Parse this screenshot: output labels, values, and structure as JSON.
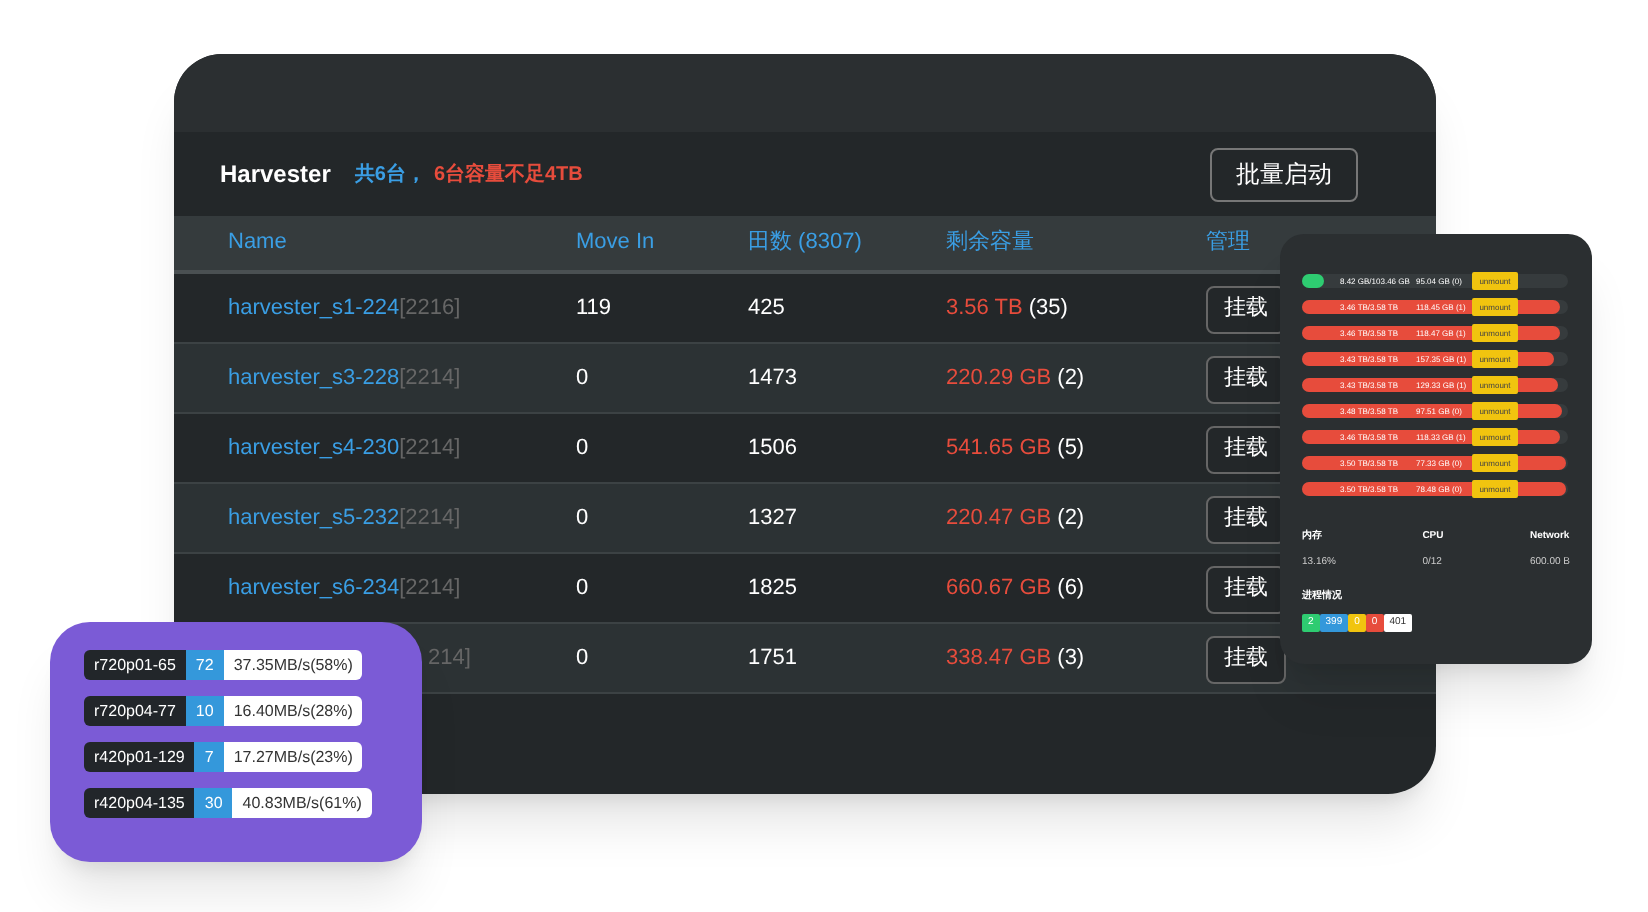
{
  "harvester": {
    "title": "Harvester",
    "summary": "共6台，",
    "warning": "6台容量不足4TB",
    "batch_button": "批量启动",
    "columns": [
      "Name",
      "Move In",
      "田数 (8307)",
      "剩余容量",
      "管理"
    ],
    "rows": [
      {
        "name": "harvester_s1-224",
        "tag": "[2216]",
        "move_in": "119",
        "plots": "425",
        "free": "3.56 TB",
        "count": "(35)",
        "action": "挂载"
      },
      {
        "name": "harvester_s3-228",
        "tag": "[2214]",
        "move_in": "0",
        "plots": "1473",
        "free": "220.29 GB",
        "count": "(2)",
        "action": "挂载"
      },
      {
        "name": "harvester_s4-230",
        "tag": "[2214]",
        "move_in": "0",
        "plots": "1506",
        "free": "541.65 GB",
        "count": "(5)",
        "action": "挂载"
      },
      {
        "name": "harvester_s5-232",
        "tag": "[2214]",
        "move_in": "0",
        "plots": "1327",
        "free": "220.47 GB",
        "count": "(2)",
        "action": "挂载"
      },
      {
        "name": "harvester_s6-234",
        "tag": "[2214]",
        "move_in": "0",
        "plots": "1825",
        "free": "660.67 GB",
        "count": "(6)",
        "action": "挂载"
      },
      {
        "name": "",
        "tag": "214]",
        "move_in": "0",
        "plots": "1751",
        "free": "338.47 GB",
        "count": "(3)",
        "action": "挂载"
      }
    ]
  },
  "disks": {
    "items": [
      {
        "used": "8.42 GB/103.46 GB",
        "free": "95.04 GB (0)",
        "level": 0.08,
        "color": "#2ecc71",
        "button": "unmount"
      },
      {
        "used": "3.46 TB/3.58 TB",
        "free": "118.45 GB (1)",
        "level": 0.97,
        "color": "#e74c3c",
        "button": "unmount"
      },
      {
        "used": "3.46 TB/3.58 TB",
        "free": "118.47 GB (1)",
        "level": 0.97,
        "color": "#e74c3c",
        "button": "unmount"
      },
      {
        "used": "3.43 TB/3.58 TB",
        "free": "157.35 GB (1)",
        "level": 0.95,
        "color": "#e74c3c",
        "button": "unmount"
      },
      {
        "used": "3.43 TB/3.58 TB",
        "free": "129.33 GB (1)",
        "level": 0.96,
        "color": "#e74c3c",
        "button": "unmount"
      },
      {
        "used": "3.48 TB/3.58 TB",
        "free": "97.51 GB (0)",
        "level": 0.98,
        "color": "#e74c3c",
        "button": "unmount"
      },
      {
        "used": "3.46 TB/3.58 TB",
        "free": "118.33 GB (1)",
        "level": 0.97,
        "color": "#e74c3c",
        "button": "unmount"
      },
      {
        "used": "3.50 TB/3.58 TB",
        "free": "77.33 GB (0)",
        "level": 0.99,
        "color": "#e74c3c",
        "button": "unmount"
      },
      {
        "used": "3.50 TB/3.58 TB",
        "free": "78.48 GB (0)",
        "level": 0.99,
        "color": "#e74c3c",
        "button": "unmount"
      }
    ],
    "stats": [
      {
        "label": "内存",
        "value": "13.16%"
      },
      {
        "label": "CPU",
        "value": "0/12"
      },
      {
        "label": "Network",
        "value": "600.00 B"
      }
    ],
    "process_title": "进程情况",
    "process_badges": [
      {
        "text": "2",
        "color": "#2ecc71"
      },
      {
        "text": "399",
        "color": "#3498db"
      },
      {
        "text": "0",
        "color": "#f1c40f"
      },
      {
        "text": "0",
        "color": "#e74c3c"
      },
      {
        "text": "401",
        "color": "#ffffff"
      }
    ]
  },
  "machines": [
    {
      "name": "r720p01-65",
      "count": "72",
      "speed": "37.35MB/s(58%)"
    },
    {
      "name": "r720p04-77",
      "count": "10",
      "speed": "16.40MB/s(28%)"
    },
    {
      "name": "r420p01-129",
      "count": "7",
      "speed": "17.27MB/s(23%)"
    },
    {
      "name": "r420p04-135",
      "count": "30",
      "speed": "40.83MB/s(61%)"
    }
  ]
}
